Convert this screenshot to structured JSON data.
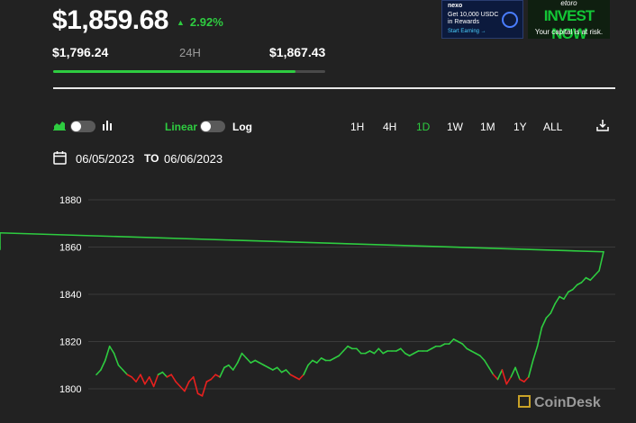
{
  "header": {
    "price": "$1,859.68",
    "change_symbol": "▲",
    "change_percent": "2.92%",
    "low": "$1,796.24",
    "period": "24H",
    "high": "$1,867.43",
    "range_position": 0.89,
    "colors": {
      "positive": "#2ecc40",
      "track": "#4a4a4a"
    }
  },
  "ads": {
    "nexo": {
      "brand": "nexo",
      "line1": "Get 10,000 USDC",
      "line2": "in Rewards",
      "cta": "Start Earning →"
    },
    "etoro": {
      "brand": "etoro",
      "headline": "INVEST NOW",
      "disclaimer": "Your capital is at risk."
    }
  },
  "controls": {
    "chart_type_icons": [
      "area-chart-icon",
      "bar-chart-icon"
    ],
    "scale_linear": "Linear",
    "scale_log": "Log",
    "timeframes": [
      "1H",
      "4H",
      "1D",
      "1W",
      "1M",
      "1Y",
      "ALL"
    ],
    "active_timeframe": "1D",
    "download_icon": "download-icon"
  },
  "dates": {
    "from": "06/05/2023",
    "to_label": "TO",
    "to": "06/06/2023"
  },
  "watermark": "CoinDesk",
  "chart_data": {
    "type": "line",
    "title": "",
    "xlabel": "",
    "ylabel": "",
    "ylim": [
      1795,
      1885
    ],
    "yticks": [
      1800,
      1820,
      1840,
      1860,
      1880
    ],
    "grid": true,
    "x": [
      0,
      1,
      2,
      3,
      4,
      5,
      6,
      7,
      8,
      9,
      10,
      11,
      12,
      13,
      14,
      15,
      16,
      17,
      18,
      19,
      20,
      21,
      22,
      23,
      24,
      25,
      26,
      27,
      28,
      29,
      30,
      31,
      32,
      33,
      34,
      35,
      36,
      37,
      38,
      39,
      40,
      41,
      42,
      43,
      44,
      45,
      46,
      47,
      48,
      49,
      50,
      51,
      52,
      53,
      54,
      55,
      56,
      57,
      58,
      59,
      60,
      61,
      62,
      63,
      64,
      65,
      66,
      67,
      68,
      69,
      70,
      71,
      72,
      73,
      74,
      75,
      76,
      77,
      78,
      79,
      80,
      81,
      82,
      83,
      84,
      85,
      86,
      87,
      88,
      89,
      90,
      91,
      92,
      93,
      94,
      95,
      96,
      97,
      98,
      99,
      100,
      101,
      102,
      103,
      104,
      105,
      106,
      107,
      108,
      109,
      110,
      111,
      112,
      113,
      114,
      115
    ],
    "values": [
      1806,
      1808,
      1812,
      1818,
      1815,
      1810,
      1808,
      1806,
      1805,
      1803,
      1806,
      1802,
      1805,
      1801,
      1806,
      1807,
      1805,
      1806,
      1803,
      1801,
      1799,
      1803,
      1805,
      1798,
      1797,
      1803,
      1804,
      1806,
      1805,
      1809,
      1810,
      1808,
      1811,
      1815,
      1813,
      1811,
      1812,
      1811,
      1810,
      1809,
      1808,
      1809,
      1807,
      1808,
      1806,
      1805,
      1804,
      1806,
      1810,
      1812,
      1811,
      1813,
      1812,
      1812,
      1813,
      1814,
      1816,
      1818,
      1817,
      1817,
      1815,
      1815,
      1816,
      1815,
      1817,
      1815,
      1816,
      1816,
      1816,
      1817,
      1815,
      1814,
      1815,
      1816,
      1816,
      1816,
      1817,
      1818,
      1818,
      1819,
      1819,
      1821,
      1820,
      1819,
      1817,
      1816,
      1815,
      1814,
      1812,
      1809,
      1806,
      1804,
      1808,
      1802,
      1805,
      1809,
      1804,
      1803,
      1805,
      1812,
      1818,
      1826,
      1830,
      1832,
      1836,
      1839,
      1838,
      1841,
      1842,
      1844,
      1845,
      1847,
      1846,
      1848,
      1850,
      1858,
      1866,
      1860,
      1859
    ],
    "series_colors": {
      "up": "#2ecc40",
      "down": "#e8201e"
    },
    "baseline": 1806
  }
}
